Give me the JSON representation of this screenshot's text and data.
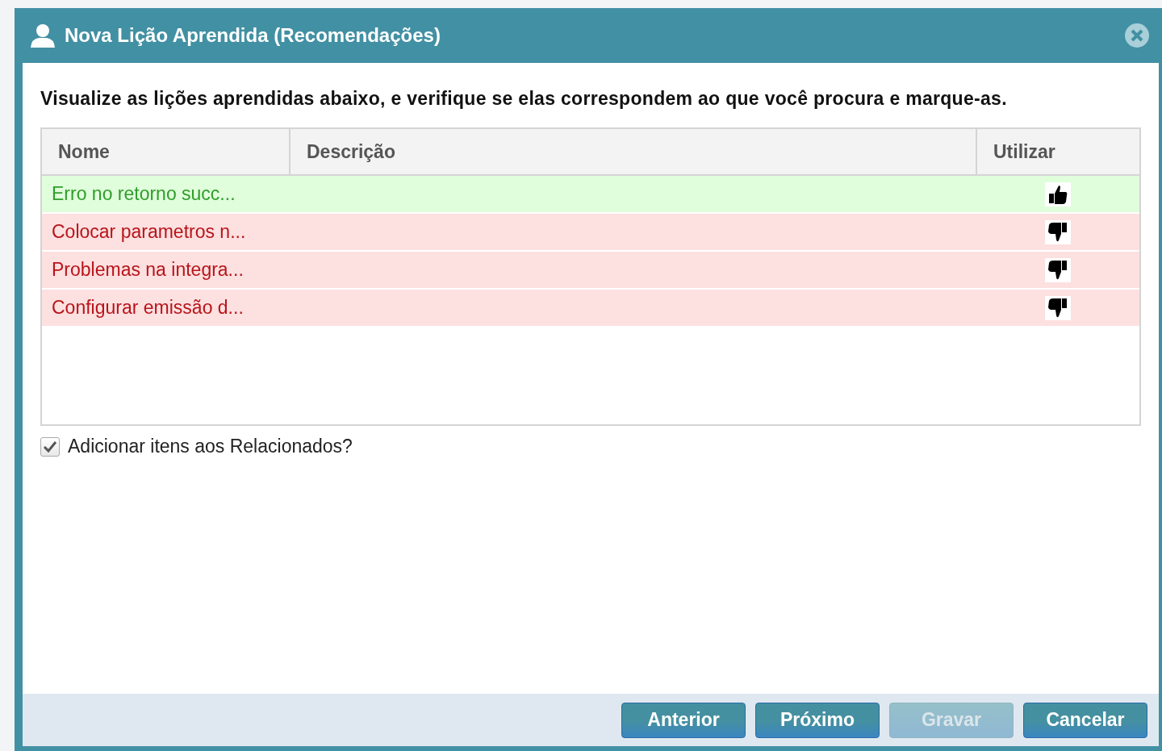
{
  "dialog": {
    "title": "Nova Lição Aprendida (Recomendações)"
  },
  "intro": "Visualize as lições aprendidas abaixo, e verifique se elas correspondem ao que você procura e marque-as.",
  "table": {
    "columns": [
      "Nome",
      "Descrição",
      "Utilizar"
    ],
    "rows": [
      {
        "name": "Erro no retorno succ...",
        "use": true
      },
      {
        "name": "Colocar parametros n...",
        "use": false
      },
      {
        "name": "Problemas na integra...",
        "use": false
      },
      {
        "name": "Configurar emissão d...",
        "use": false
      }
    ]
  },
  "add_related": {
    "label": "Adicionar itens aos Relacionados?",
    "checked": true
  },
  "buttons": [
    {
      "label": "Anterior",
      "disabled": false
    },
    {
      "label": "Próximo",
      "disabled": false
    },
    {
      "label": "Gravar",
      "disabled": true
    },
    {
      "label": "Cancelar",
      "disabled": false
    }
  ]
}
